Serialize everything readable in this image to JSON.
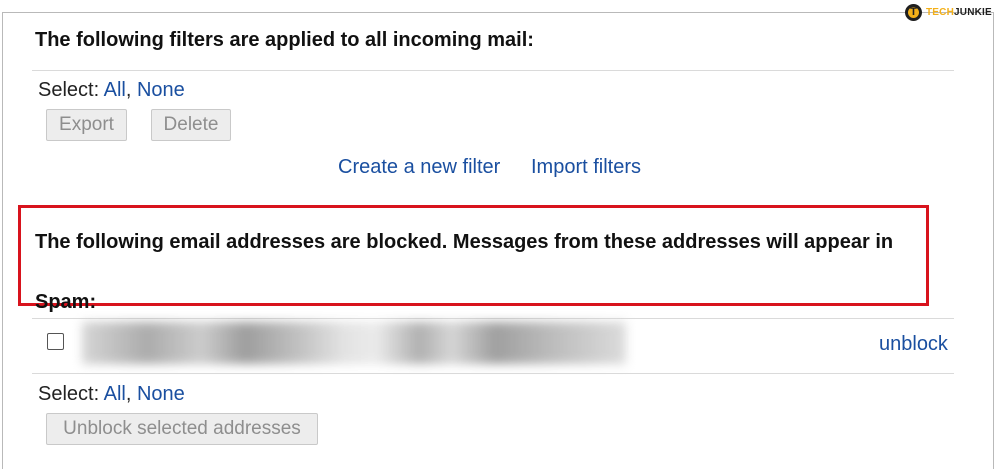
{
  "watermark": {
    "tech": "TECH",
    "junkie": "JUNKIE",
    "logo_letter": "T"
  },
  "filters": {
    "heading": "The following filters are applied to all incoming mail:",
    "select_label": "Select:",
    "select_all": "All",
    "select_none": "None",
    "export_button": "Export",
    "delete_button": "Delete",
    "create_filter_link": "Create a new filter",
    "import_filters_link": "Import filters"
  },
  "blocked": {
    "heading_line1": "The following email addresses are blocked. Messages from these addresses will appear in",
    "heading_line2": "Spam:",
    "rows": [
      {
        "address": "",
        "unblock_label": "unblock",
        "checked": false
      }
    ],
    "select_label": "Select:",
    "select_all": "All",
    "select_none": "None",
    "unblock_selected_button": "Unblock selected addresses"
  },
  "colors": {
    "link": "#1a4fa0",
    "highlight_border": "#d8131d",
    "button_text_disabled": "#8e8e8e"
  }
}
